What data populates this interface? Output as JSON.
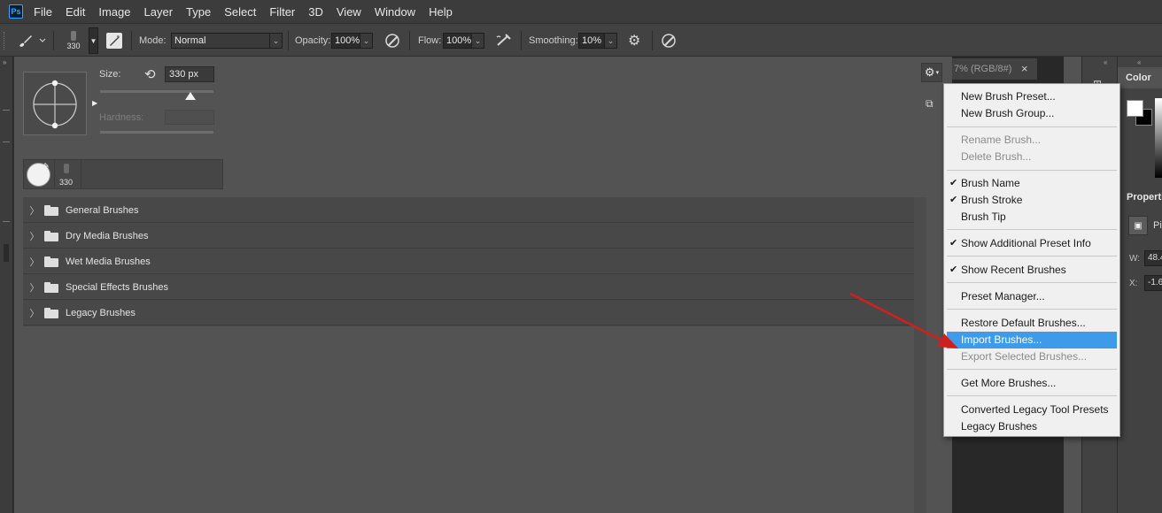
{
  "app": {
    "logo_text": "Ps"
  },
  "menubar": {
    "items": [
      "File",
      "Edit",
      "Image",
      "Layer",
      "Type",
      "Select",
      "Filter",
      "3D",
      "View",
      "Window",
      "Help"
    ]
  },
  "options": {
    "brush_size": "330",
    "mode_label": "Mode:",
    "mode_value": "Normal",
    "opacity_label": "Opacity:",
    "opacity_value": "100%",
    "flow_label": "Flow:",
    "flow_value": "100%",
    "smoothing_label": "Smoothing:",
    "smoothing_value": "10%"
  },
  "brush_panel": {
    "size_label": "Size:",
    "size_value": "330 px",
    "size_slider_fraction": 0.8,
    "hardness_label": "Hardness:",
    "recent_brush_size": "330",
    "groups": [
      {
        "label": "General Brushes"
      },
      {
        "label": "Dry Media Brushes"
      },
      {
        "label": "Wet Media Brushes"
      },
      {
        "label": "Special Effects Brushes"
      },
      {
        "label": "Legacy Brushes"
      }
    ]
  },
  "document": {
    "tab_title": "7% (RGB/8#)",
    "close_glyph": "×"
  },
  "right_panels": {
    "color_tab": "Color",
    "properties_tab": "Properties",
    "pixel_label": "Pi",
    "w_label": "W:",
    "w_value": "48.4",
    "x_label": "X:",
    "x_value": "-1.6"
  },
  "context_menu": {
    "items": [
      {
        "label": "New Brush Preset...",
        "disabled": false,
        "checked": false
      },
      {
        "label": "New Brush Group...",
        "disabled": false,
        "checked": false
      },
      {
        "label": "Rename Brush...",
        "disabled": true,
        "checked": false
      },
      {
        "label": "Delete Brush...",
        "disabled": true,
        "checked": false
      },
      {
        "label": "Brush Name",
        "disabled": false,
        "checked": true
      },
      {
        "label": "Brush Stroke",
        "disabled": false,
        "checked": true
      },
      {
        "label": "Brush Tip",
        "disabled": false,
        "checked": false
      },
      {
        "label": "Show Additional Preset Info",
        "disabled": false,
        "checked": true
      },
      {
        "label": "Show Recent Brushes",
        "disabled": false,
        "checked": true
      },
      {
        "label": "Preset Manager...",
        "disabled": false,
        "checked": false
      },
      {
        "label": "Restore Default Brushes...",
        "disabled": false,
        "checked": false
      },
      {
        "label": "Import Brushes...",
        "disabled": false,
        "checked": false,
        "highlighted": true
      },
      {
        "label": "Export Selected Brushes...",
        "disabled": true,
        "checked": false
      },
      {
        "label": "Get More Brushes...",
        "disabled": false,
        "checked": false
      },
      {
        "label": "Converted Legacy Tool Presets",
        "disabled": false,
        "checked": false
      },
      {
        "label": "Legacy Brushes",
        "disabled": false,
        "checked": false
      }
    ]
  },
  "colors": {
    "highlight": "#3d9be9",
    "annotation_arrow": "#d0201e"
  }
}
